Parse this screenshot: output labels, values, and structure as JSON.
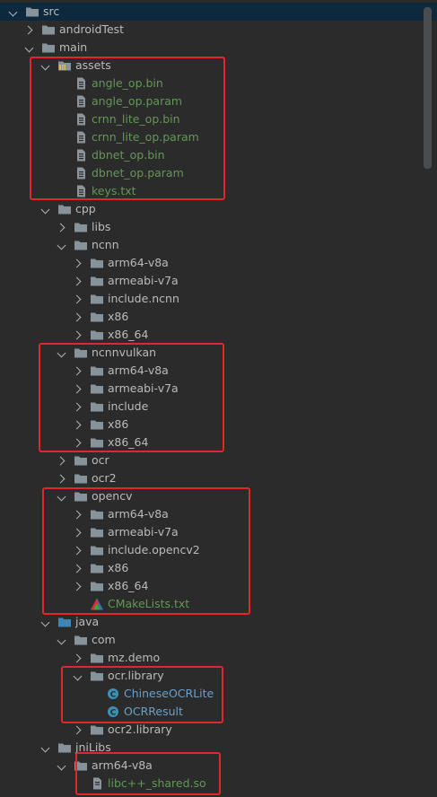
{
  "tree": {
    "src": "src",
    "androidTest": "androidTest",
    "main": "main",
    "assets": "assets",
    "assets_files": [
      "angle_op.bin",
      "angle_op.param",
      "crnn_lite_op.bin",
      "crnn_lite_op.param",
      "dbnet_op.bin",
      "dbnet_op.param",
      "keys.txt"
    ],
    "cpp": "cpp",
    "libs": "libs",
    "ncnn": "ncnn",
    "ncnn_children": [
      "arm64-v8a",
      "armeabi-v7a",
      "include.ncnn",
      "x86",
      "x86_64"
    ],
    "ncnnvulkan": "ncnnvulkan",
    "ncnnvulkan_children": [
      "arm64-v8a",
      "armeabi-v7a",
      "include",
      "x86",
      "x86_64"
    ],
    "ocr": "ocr",
    "ocr2": "ocr2",
    "opencv": "opencv",
    "opencv_children": [
      "arm64-v8a",
      "armeabi-v7a",
      "include.opencv2",
      "x86",
      "x86_64"
    ],
    "cmakelists": "CMakeLists.txt",
    "java": "java",
    "com": "com",
    "mz_demo": "mz.demo",
    "ocr_library": "ocr.library",
    "ocr_library_classes": [
      "ChineseOCRLite",
      "OCRResult"
    ],
    "ocr2_library": "ocr2.library",
    "jniLibs": "jniLibs",
    "jni_arm64": "arm64-v8a",
    "libcxx": "libc++_shared.so"
  },
  "colors": {
    "background": "#2b2b2b",
    "text": "#bbbbbb",
    "resource_green": "#629755",
    "class_blue": "#6aa0c8",
    "folder": "#87939a",
    "highlight_box": "#e4262a"
  }
}
